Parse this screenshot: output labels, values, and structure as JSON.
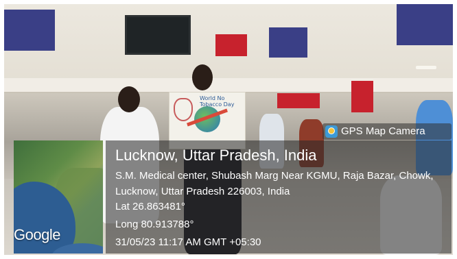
{
  "overlay": {
    "app_badge": "GPS Map Camera",
    "map_brand": "Google",
    "location_title": "Lucknow, Uttar Pradesh, India",
    "address": "S.M. Medical center, Shubash Marg Near KGMU, Raja Bazar, Chowk, Lucknow, Uttar Pradesh 226003, India",
    "latitude": "Lat 26.863481°",
    "longitude": "Long 80.913788°",
    "timestamp": "31/05/23 11:17 AM GMT +05:30"
  },
  "scene": {
    "poster_text": "World No Tobacco Day",
    "colors": {
      "sign_blue": "#3a3f86",
      "sign_red": "#c7222d",
      "overlay_bg": "rgba(40,40,40,0.55)"
    }
  }
}
